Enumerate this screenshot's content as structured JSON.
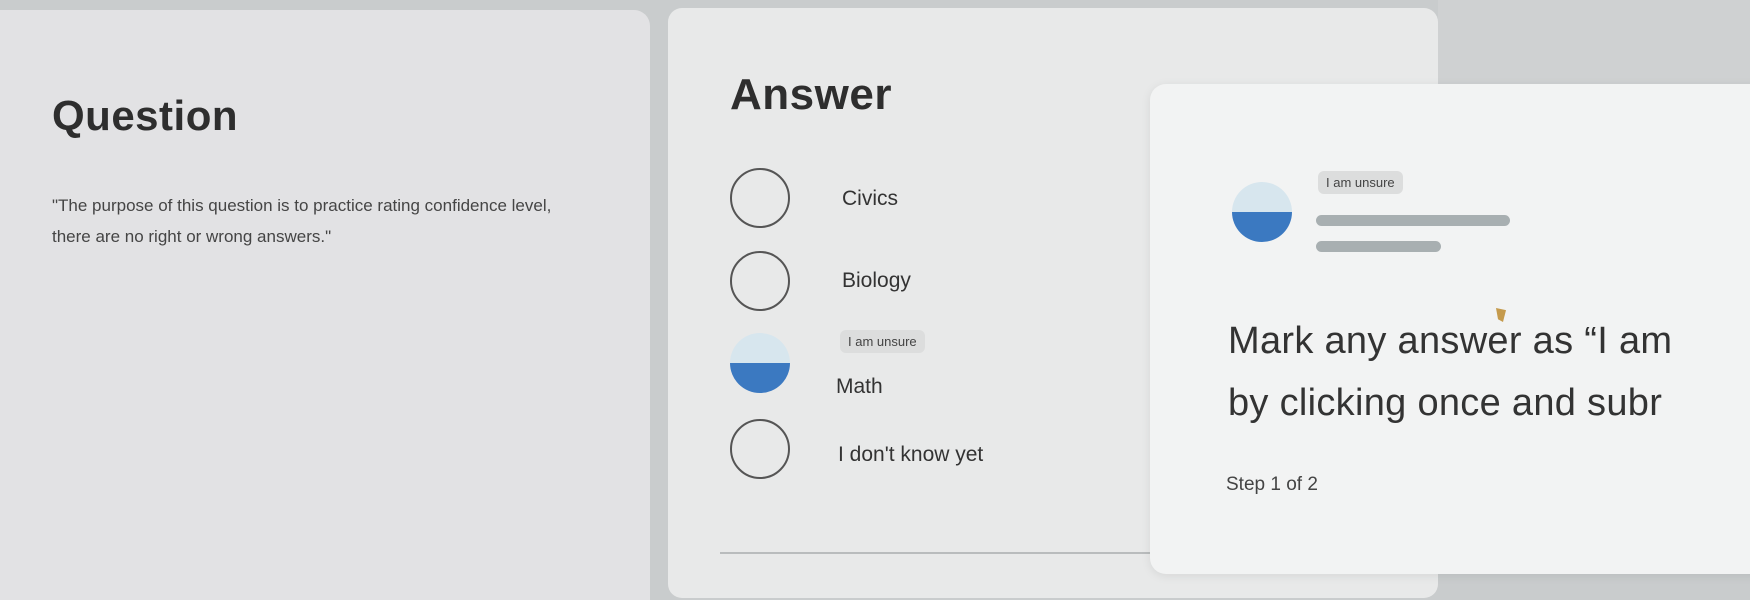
{
  "question": {
    "title": "Question",
    "text": "\"The purpose of this question is to practice rating confidence level, there are no right or wrong answers.\""
  },
  "answer": {
    "title": "Answer",
    "options": [
      {
        "label": "Civics",
        "state": "empty"
      },
      {
        "label": "Biology",
        "state": "empty"
      },
      {
        "label": "Math",
        "state": "half",
        "badge": "I am unsure"
      },
      {
        "label": "I don't know yet",
        "state": "empty"
      }
    ]
  },
  "tooltip": {
    "badge": "I am unsure",
    "line1": "Mark any answer as “I am",
    "line2": "by clicking once and subr",
    "step": "Step 1 of 2"
  },
  "colors": {
    "accent_blue": "#3b79c1",
    "half_fill_light": "#d7e6ee"
  }
}
